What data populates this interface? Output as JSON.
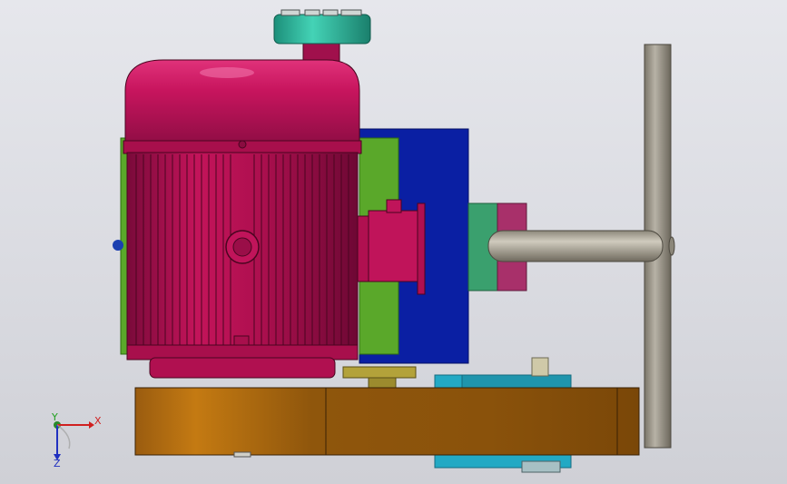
{
  "viewport": {
    "background": "#dcdde3"
  },
  "model": {
    "parts": [
      {
        "name": "motor-housing",
        "color": "#c0145a"
      },
      {
        "name": "motor-pulley",
        "color": "#2fb49a"
      },
      {
        "name": "green-mounting-plate",
        "color": "#5aa82a"
      },
      {
        "name": "blue-gearbox",
        "color": "#0a1fa3"
      },
      {
        "name": "coupling-green",
        "color": "#3aa06e"
      },
      {
        "name": "coupling-magenta",
        "color": "#a8306a"
      },
      {
        "name": "output-shaft",
        "color": "#a7a192"
      },
      {
        "name": "vertical-post",
        "color": "#9a958a"
      },
      {
        "name": "wooden-base",
        "color": "#a8620e"
      },
      {
        "name": "cyan-bracket",
        "color": "#23a9c4"
      }
    ]
  },
  "triad": {
    "x_label": "X",
    "y_label": "Y",
    "z_label": "Z",
    "x_color": "#d02020",
    "y_color": "#20a020",
    "z_color": "#2030c0"
  }
}
